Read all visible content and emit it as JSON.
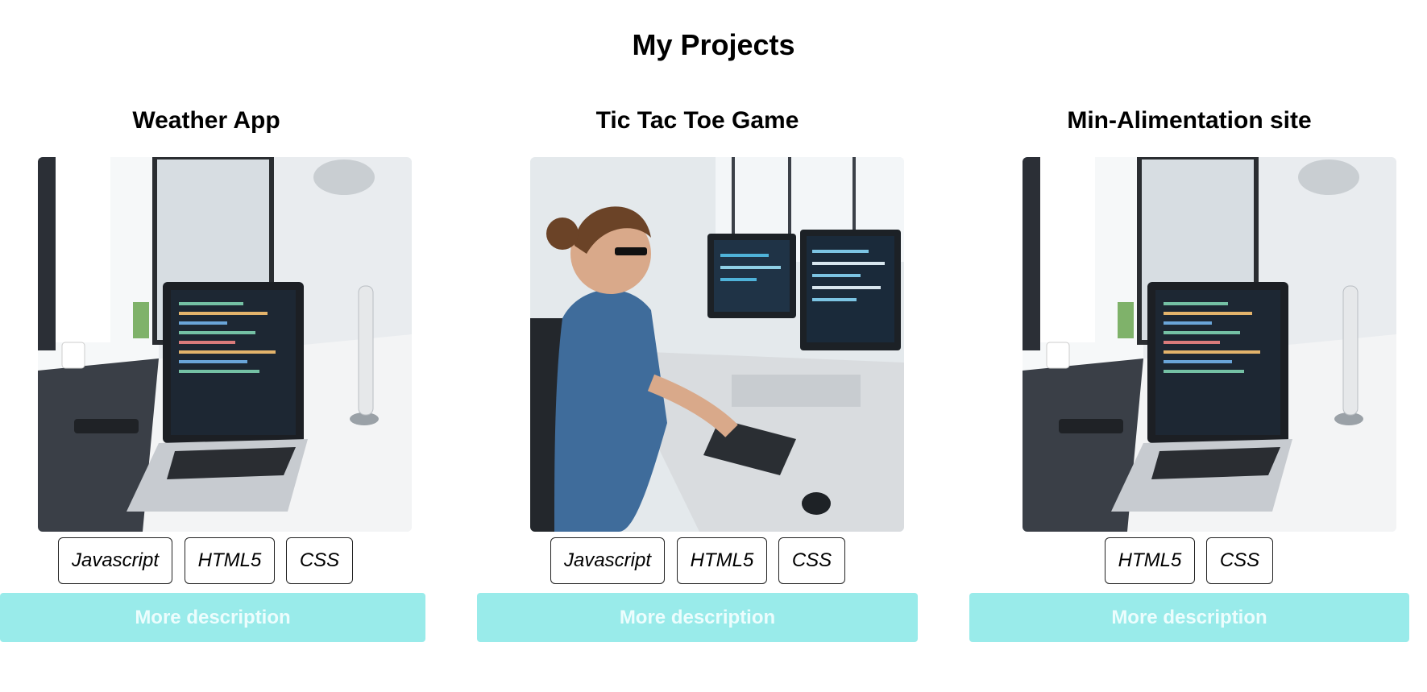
{
  "page": {
    "title": "My Projects"
  },
  "colors": {
    "button_bg": "#99ebea",
    "button_text": "#ecfdfd",
    "tag_border": "#222222"
  },
  "projects": [
    {
      "title": "Weather App",
      "image": "laptop-desk-photo",
      "tags": [
        "Javascript",
        "HTML5",
        "CSS"
      ],
      "button_label": "More description"
    },
    {
      "title": "Tic Tac Toe Game",
      "image": "programmer-at-monitors-photo",
      "tags": [
        "Javascript",
        "HTML5",
        "CSS"
      ],
      "button_label": "More description"
    },
    {
      "title": "Min-Alimentation site",
      "image": "laptop-desk-photo",
      "tags": [
        "HTML5",
        "CSS"
      ],
      "button_label": "More description"
    }
  ]
}
